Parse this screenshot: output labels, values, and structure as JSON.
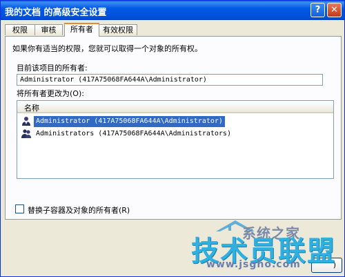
{
  "window": {
    "title": "我的文档 的高级安全设置"
  },
  "titlebar": {
    "help_label": "?",
    "close_label": "✕"
  },
  "tabs": [
    {
      "label": "权限",
      "active": false
    },
    {
      "label": "审核",
      "active": false
    },
    {
      "label": "所有者",
      "active": true
    },
    {
      "label": "有效权限",
      "active": false
    }
  ],
  "owner": {
    "intro": "如果你有适当的权限，您就可以取得一个对象的所有权。",
    "current_label": "目前该项目的所有者:",
    "current_value": "Administrator (417A75068FA644A\\Administrator)",
    "change_label": "将所有者更改为(O):"
  },
  "list": {
    "header": "名称",
    "items": [
      {
        "label": "Administrator (417A75068FA644A\\Administrator)",
        "selected": true,
        "icon": "user-icon"
      },
      {
        "label": "Administrators (417A75068FA644A\\Administrators)",
        "selected": false,
        "icon": "group-icon"
      }
    ]
  },
  "replace_checkbox": {
    "label": "替换子容器及对象的所有者(R)",
    "checked": false
  },
  "bottom_button": {
    "label": ")"
  },
  "watermark": {
    "logo": "系统之家",
    "name": "技术员联盟",
    "url": "www.jsgho.com"
  },
  "colors": {
    "selection": "#316ac5",
    "titlebar": "#0058e6",
    "watermark": "#2fb0e0"
  }
}
